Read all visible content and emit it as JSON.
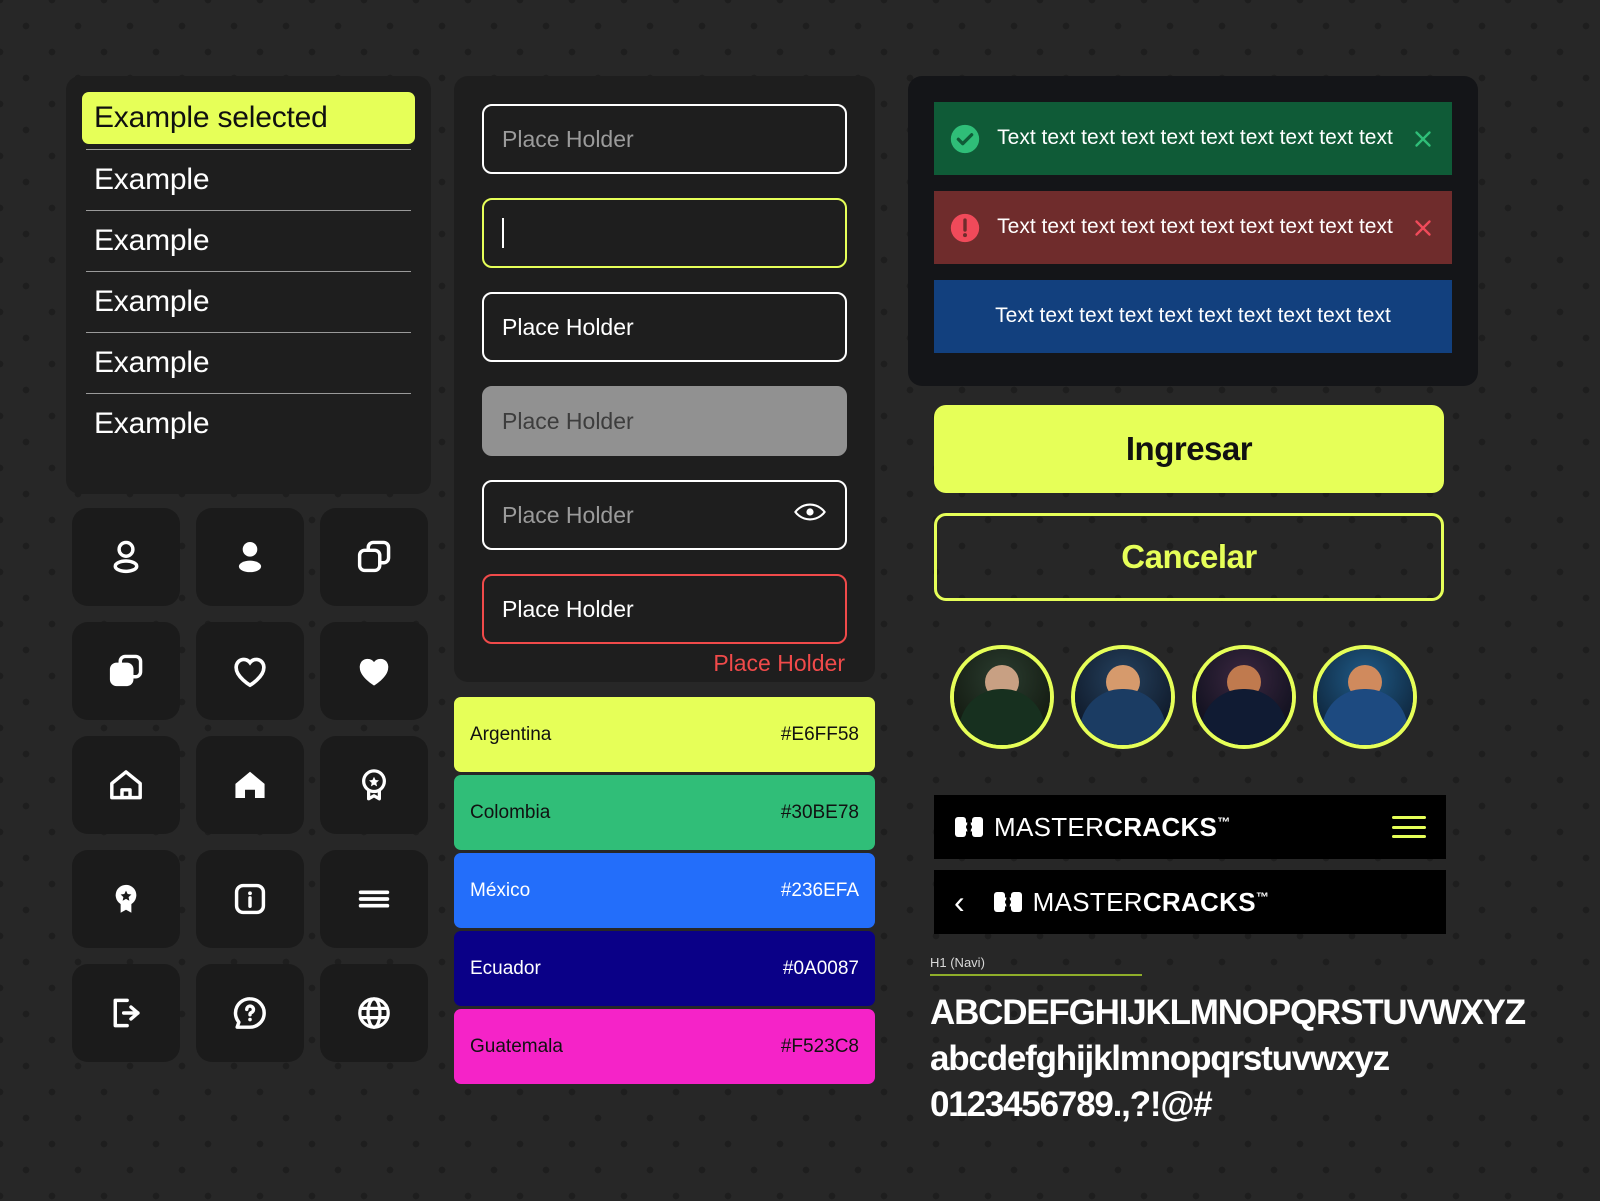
{
  "theme": {
    "accent": "#E6FF58",
    "background": "#272727",
    "panel": "#1E1E1E",
    "alert_panel": "#141518",
    "error": "#F04A4A",
    "white": "#FFFFFF"
  },
  "dropdown": {
    "items": [
      {
        "label": "Example selected",
        "selected": true
      },
      {
        "label": "Example",
        "selected": false
      },
      {
        "label": "Example",
        "selected": false
      },
      {
        "label": "Example",
        "selected": false
      },
      {
        "label": "Example",
        "selected": false
      },
      {
        "label": "Example",
        "selected": false
      }
    ]
  },
  "icons": [
    {
      "name": "user-outline-icon"
    },
    {
      "name": "user-filled-icon"
    },
    {
      "name": "copy-outline-icon"
    },
    {
      "name": "copy-filled-icon"
    },
    {
      "name": "heart-outline-icon"
    },
    {
      "name": "heart-filled-icon"
    },
    {
      "name": "home-outline-icon"
    },
    {
      "name": "home-filled-icon"
    },
    {
      "name": "badge-outline-icon"
    },
    {
      "name": "badge-filled-icon"
    },
    {
      "name": "info-box-icon"
    },
    {
      "name": "hamburger-menu-icon"
    },
    {
      "name": "logout-icon"
    },
    {
      "name": "help-question-icon"
    },
    {
      "name": "globe-icon"
    }
  ],
  "inputs": {
    "default": {
      "placeholder": "Place Holder",
      "value": ""
    },
    "focused": {
      "placeholder": "",
      "value": ""
    },
    "filled": {
      "placeholder": "Place Holder",
      "value": "Place Holder"
    },
    "disabled": {
      "placeholder": "Place Holder",
      "value": ""
    },
    "password": {
      "placeholder": "Place Holder",
      "value": "",
      "toggle_icon": "eye-icon"
    },
    "error": {
      "placeholder": "Place Holder",
      "value": "Place Holder",
      "message": "Place Holder"
    }
  },
  "swatches": [
    {
      "name": "Argentina",
      "hex": "#E6FF58",
      "text": "#111111"
    },
    {
      "name": "Colombia",
      "hex": "#30BE78",
      "text": "#111111"
    },
    {
      "name": "México",
      "hex": "#236EFA",
      "text": "#FFFFFF"
    },
    {
      "name": "Ecuador",
      "hex": "#0A0087",
      "text": "#FFFFFF"
    },
    {
      "name": "Guatemala",
      "hex": "#F523C8",
      "text": "#111111"
    }
  ],
  "alerts": [
    {
      "type": "success",
      "text": "Text text text text text text text text text text",
      "icon": "check-circle-icon",
      "close_icon": "close-icon",
      "bg": "#0F5B37",
      "icon_color": "#2FBE78"
    },
    {
      "type": "error",
      "text": "Text text text text text text text text text text",
      "icon": "alert-circle-icon",
      "close_icon": "close-icon",
      "bg": "#6F2C2C",
      "icon_color": "#F04A5A"
    },
    {
      "type": "info",
      "text": "Text text text text text text text text text text",
      "icon": "",
      "close_icon": "",
      "bg": "#12407E",
      "icon_color": ""
    }
  ],
  "buttons": {
    "primary": "Ingresar",
    "secondary": "Cancelar"
  },
  "avatars": [
    {
      "label": "avatar-1",
      "shirt": "#17301f",
      "skin": "#c8a083",
      "tint": "#1d3b2a"
    },
    {
      "label": "avatar-2",
      "shirt": "#1b3c63",
      "skin": "#d69a6c",
      "tint": "#21456e"
    },
    {
      "label": "avatar-3",
      "shirt": "#101b33",
      "skin": "#c07a4e",
      "tint": "#2a1d3a"
    },
    {
      "label": "avatar-4",
      "shirt": "#1d4a80",
      "skin": "#d08a5d",
      "tint": "#1a5580"
    }
  ],
  "navbar": {
    "brand_light": "MASTER",
    "brand_bold": "CRACKS",
    "brand_tm": "™",
    "menu_icon": "hamburger-menu-icon",
    "back_icon": "chevron-left-icon",
    "back_glyph": "‹",
    "logo_icon": "mastercracks-logo-icon"
  },
  "typography": {
    "label": "H1 (Navi)",
    "uppercase": "ABCDEFGHIJKLMNOPQRSTUVWXYZ",
    "lowercase": "abcdefghijklmnopqrstuvwxyz",
    "numbers": "0123456789.,?!@#"
  }
}
